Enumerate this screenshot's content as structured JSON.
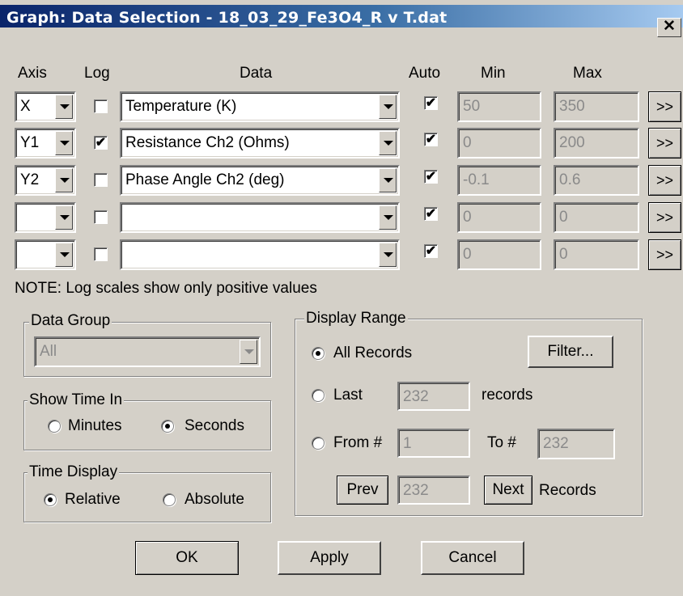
{
  "window": {
    "title": "Graph: Data Selection - 18_03_29_Fe3O4_R v T.dat",
    "close_glyph": "✕"
  },
  "headers": {
    "axis": "Axis",
    "log": "Log",
    "data": "Data",
    "auto": "Auto",
    "min": "Min",
    "max": "Max"
  },
  "rows": [
    {
      "axis": "X",
      "log": false,
      "data": "Temperature (K)",
      "auto": true,
      "min": "50",
      "max": "350",
      "more": ">>"
    },
    {
      "axis": "Y1",
      "log": true,
      "data": "Resistance Ch2 (Ohms)",
      "auto": true,
      "min": "0",
      "max": "200",
      "more": ">>"
    },
    {
      "axis": "Y2",
      "log": false,
      "data": "Phase Angle Ch2 (deg)",
      "auto": true,
      "min": "-0.1",
      "max": "0.6",
      "more": ">>"
    },
    {
      "axis": "",
      "log": false,
      "data": "",
      "auto": true,
      "min": "0",
      "max": "0",
      "more": ">>"
    },
    {
      "axis": "",
      "log": false,
      "data": "",
      "auto": true,
      "min": "0",
      "max": "0",
      "more": ">>"
    }
  ],
  "note": "NOTE: Log scales show only positive values",
  "data_group": {
    "legend": "Data Group",
    "value": "All"
  },
  "show_time_in": {
    "legend": "Show Time In",
    "minutes": "Minutes",
    "seconds": "Seconds",
    "selected": "seconds"
  },
  "time_display": {
    "legend": "Time Display",
    "relative": "Relative",
    "absolute": "Absolute",
    "selected": "relative"
  },
  "display_range": {
    "legend": "Display Range",
    "all_records": "All Records",
    "filter_button": "Filter...",
    "last": "Last",
    "last_value": "232",
    "records_suffix": "records",
    "from": "From #",
    "from_value": "1",
    "to": "To #",
    "to_value": "232",
    "prev_button": "Prev",
    "step_value": "232",
    "next_button": "Next",
    "records_label": "Records",
    "selected": "all"
  },
  "buttons": {
    "ok": "OK",
    "apply": "Apply",
    "cancel": "Cancel"
  }
}
